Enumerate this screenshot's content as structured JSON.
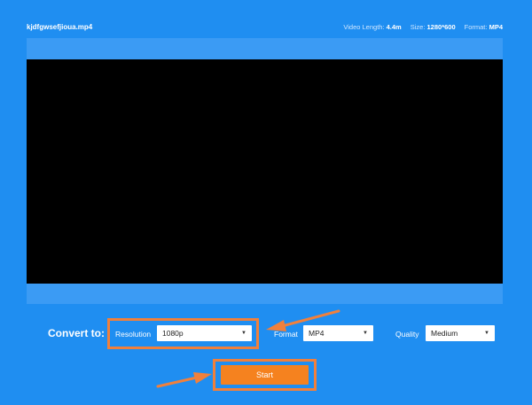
{
  "header": {
    "filename": "kjdfgwsefjioua.mp4",
    "video_length_label": "Video Length:",
    "video_length_value": "4.4m",
    "size_label": "Size:",
    "size_value": "1280*600",
    "format_label": "Format:",
    "format_value": "MP4"
  },
  "convert": {
    "title": "Convert to:",
    "resolution_label": "Resolution",
    "resolution_value": "1080p",
    "format_label": "Format",
    "format_value": "MP4",
    "quality_label": "Quality",
    "quality_value": "Medium"
  },
  "actions": {
    "start_label": "Start"
  },
  "colors": {
    "background": "#1f8ef1",
    "player_frame": "#3b9bf4",
    "accent_orange": "#f5821f",
    "annotation": "#f0803c"
  }
}
